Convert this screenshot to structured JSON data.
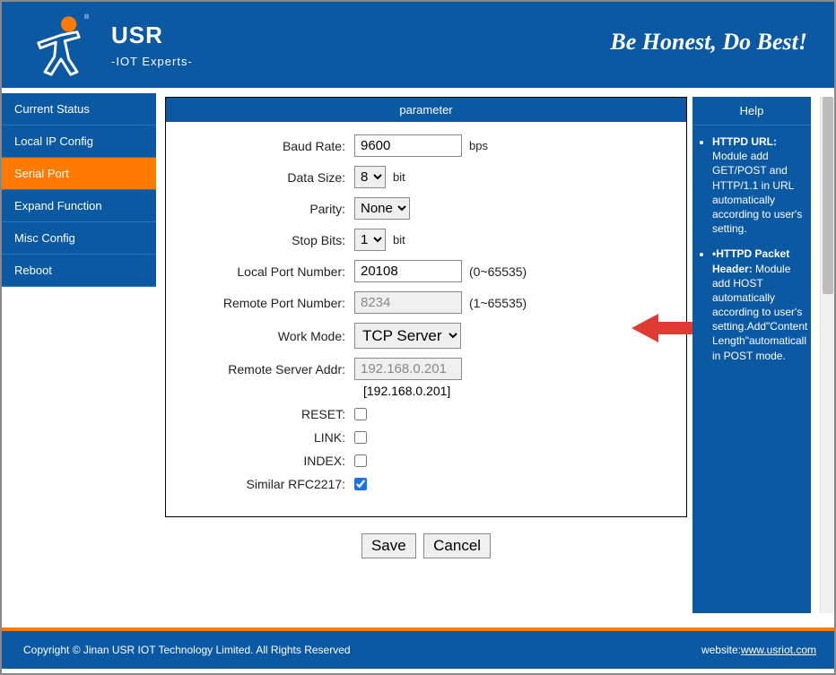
{
  "header": {
    "brand": "USR",
    "subtitle": "-IOT Experts-",
    "slogan": "Be Honest, Do Best!"
  },
  "sidebar": {
    "items": [
      {
        "label": "Current Status",
        "active": false
      },
      {
        "label": "Local IP Config",
        "active": false
      },
      {
        "label": "Serial Port",
        "active": true
      },
      {
        "label": "Expand Function",
        "active": false
      },
      {
        "label": "Misc Config",
        "active": false
      },
      {
        "label": "Reboot",
        "active": false
      }
    ]
  },
  "form": {
    "title": "parameter",
    "baud_rate": {
      "label": "Baud Rate:",
      "value": "9600",
      "unit": "bps"
    },
    "data_size": {
      "label": "Data Size:",
      "value": "8",
      "unit": "bit"
    },
    "parity": {
      "label": "Parity:",
      "value": "None"
    },
    "stop_bits": {
      "label": "Stop Bits:",
      "value": "1",
      "unit": "bit"
    },
    "local_port": {
      "label": "Local Port Number:",
      "value": "20108",
      "hint": "(0~65535)"
    },
    "remote_port": {
      "label": "Remote Port Number:",
      "value": "8234",
      "hint": "(1~65535)"
    },
    "work_mode": {
      "label": "Work Mode:",
      "value": "TCP Server"
    },
    "remote_addr": {
      "label": "Remote Server Addr:",
      "value": "192.168.0.201",
      "sub": "[192.168.0.201]"
    },
    "reset": {
      "label": "RESET:",
      "checked": false
    },
    "link": {
      "label": "LINK:",
      "checked": false
    },
    "index": {
      "label": "INDEX:",
      "checked": false
    },
    "rfc2217": {
      "label": "Similar RFC2217:",
      "checked": true
    },
    "save": "Save",
    "cancel": "Cancel"
  },
  "help": {
    "title": "Help",
    "items": [
      {
        "heading": "HTTPD URL:",
        "body": "Module add GET/POST and HTTP/1.1 in URL automatically according to user's setting."
      },
      {
        "heading": "•HTTPD Packet Header:",
        "body": "Module add HOST automatically according to user's setting.Add\"Content Length\"automaticall in POST mode."
      }
    ]
  },
  "footer": {
    "copyright": "Copyright © Jinan USR IOT Technology Limited. All Rights Reserved",
    "website_label": "website:",
    "website_url": "www.usriot.com"
  }
}
